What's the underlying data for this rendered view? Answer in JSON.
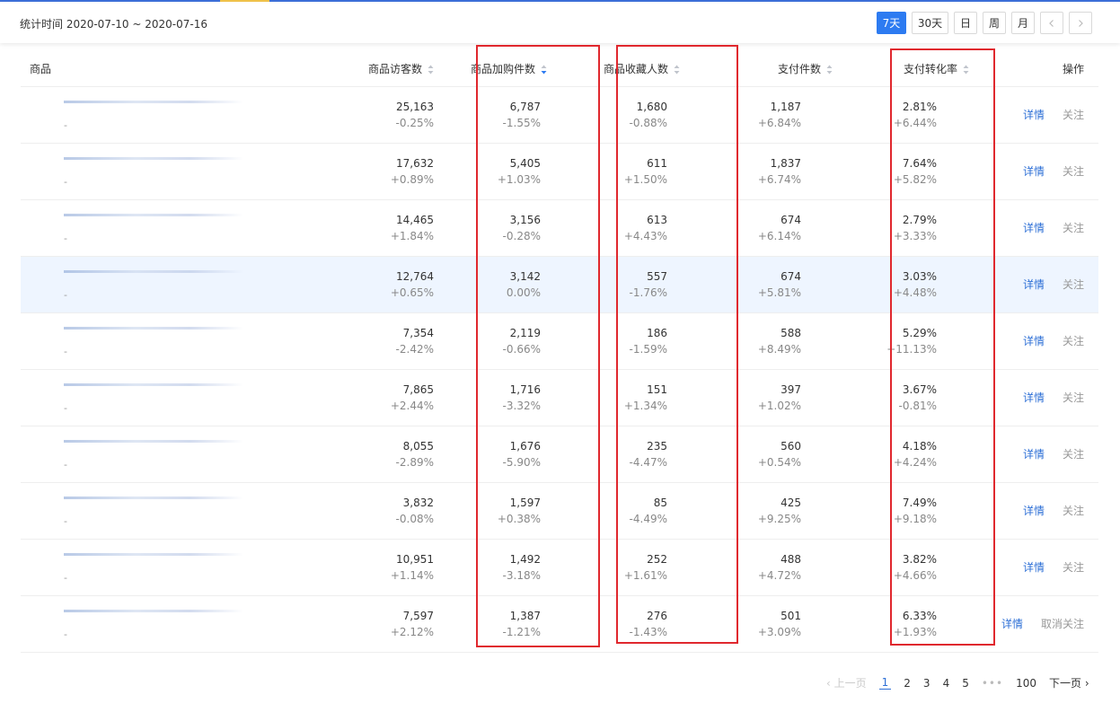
{
  "header": {
    "date_range": "统计时间 2020-07-10 ~ 2020-07-16",
    "tabs": [
      "7天",
      "30天",
      "日",
      "周",
      "月"
    ],
    "active_tab": "7天"
  },
  "table": {
    "headers": {
      "product": "商品",
      "visitors": "商品访客数",
      "cart": "商品加购件数",
      "favorites": "商品收藏人数",
      "paid": "支付件数",
      "conversion": "支付转化率",
      "ops": "操作"
    },
    "rows": [
      {
        "visitors": "25,163",
        "visitors_chg": "-0.25%",
        "cart": "6,787",
        "cart_chg": "-1.55%",
        "fav": "1,680",
        "fav_chg": "-0.88%",
        "paid": "1,187",
        "paid_chg": "+6.84%",
        "conv": "2.81%",
        "conv_chg": "+6.44%",
        "detail": "详情",
        "follow": "关注",
        "sub": "-"
      },
      {
        "visitors": "17,632",
        "visitors_chg": "+0.89%",
        "cart": "5,405",
        "cart_chg": "+1.03%",
        "fav": "611",
        "fav_chg": "+1.50%",
        "paid": "1,837",
        "paid_chg": "+6.74%",
        "conv": "7.64%",
        "conv_chg": "+5.82%",
        "detail": "详情",
        "follow": "关注",
        "sub": "-"
      },
      {
        "visitors": "14,465",
        "visitors_chg": "+1.84%",
        "cart": "3,156",
        "cart_chg": "-0.28%",
        "fav": "613",
        "fav_chg": "+4.43%",
        "paid": "674",
        "paid_chg": "+6.14%",
        "conv": "2.79%",
        "conv_chg": "+3.33%",
        "detail": "详情",
        "follow": "关注",
        "sub": "-"
      },
      {
        "visitors": "12,764",
        "visitors_chg": "+0.65%",
        "cart": "3,142",
        "cart_chg": "0.00%",
        "fav": "557",
        "fav_chg": "-1.76%",
        "paid": "674",
        "paid_chg": "+5.81%",
        "conv": "3.03%",
        "conv_chg": "+4.48%",
        "detail": "详情",
        "follow": "关注",
        "sub": "-"
      },
      {
        "visitors": "7,354",
        "visitors_chg": "-2.42%",
        "cart": "2,119",
        "cart_chg": "-0.66%",
        "fav": "186",
        "fav_chg": "-1.59%",
        "paid": "588",
        "paid_chg": "+8.49%",
        "conv": "5.29%",
        "conv_chg": "+11.13%",
        "detail": "详情",
        "follow": "关注",
        "sub": "-"
      },
      {
        "visitors": "7,865",
        "visitors_chg": "+2.44%",
        "cart": "1,716",
        "cart_chg": "-3.32%",
        "fav": "151",
        "fav_chg": "+1.34%",
        "paid": "397",
        "paid_chg": "+1.02%",
        "conv": "3.67%",
        "conv_chg": "-0.81%",
        "detail": "详情",
        "follow": "关注",
        "sub": "-"
      },
      {
        "visitors": "8,055",
        "visitors_chg": "-2.89%",
        "cart": "1,676",
        "cart_chg": "-5.90%",
        "fav": "235",
        "fav_chg": "-4.47%",
        "paid": "560",
        "paid_chg": "+0.54%",
        "conv": "4.18%",
        "conv_chg": "+4.24%",
        "detail": "详情",
        "follow": "关注",
        "sub": "-"
      },
      {
        "visitors": "3,832",
        "visitors_chg": "-0.08%",
        "cart": "1,597",
        "cart_chg": "+0.38%",
        "fav": "85",
        "fav_chg": "-4.49%",
        "paid": "425",
        "paid_chg": "+9.25%",
        "conv": "7.49%",
        "conv_chg": "+9.18%",
        "detail": "详情",
        "follow": "关注",
        "sub": "-"
      },
      {
        "visitors": "10,951",
        "visitors_chg": "+1.14%",
        "cart": "1,492",
        "cart_chg": "-3.18%",
        "fav": "252",
        "fav_chg": "+1.61%",
        "paid": "488",
        "paid_chg": "+4.72%",
        "conv": "3.82%",
        "conv_chg": "+4.66%",
        "detail": "详情",
        "follow": "关注",
        "sub": "-"
      },
      {
        "visitors": "7,597",
        "visitors_chg": "+2.12%",
        "cart": "1,387",
        "cart_chg": "-1.21%",
        "fav": "276",
        "fav_chg": "-1.43%",
        "paid": "501",
        "paid_chg": "+3.09%",
        "conv": "6.33%",
        "conv_chg": "+1.93%",
        "detail": "详情",
        "follow": "取消关注",
        "sub": "-"
      }
    ]
  },
  "pagination": {
    "prev": "上一页",
    "pages": [
      "1",
      "2",
      "3",
      "4",
      "5"
    ],
    "ellipsis": "•••",
    "last": "100",
    "next": "下一页",
    "current": "1"
  },
  "colors": {
    "accent": "#2d7bf1",
    "highlight_box": "#e0282e",
    "row_highlight": "#eef5ff"
  }
}
